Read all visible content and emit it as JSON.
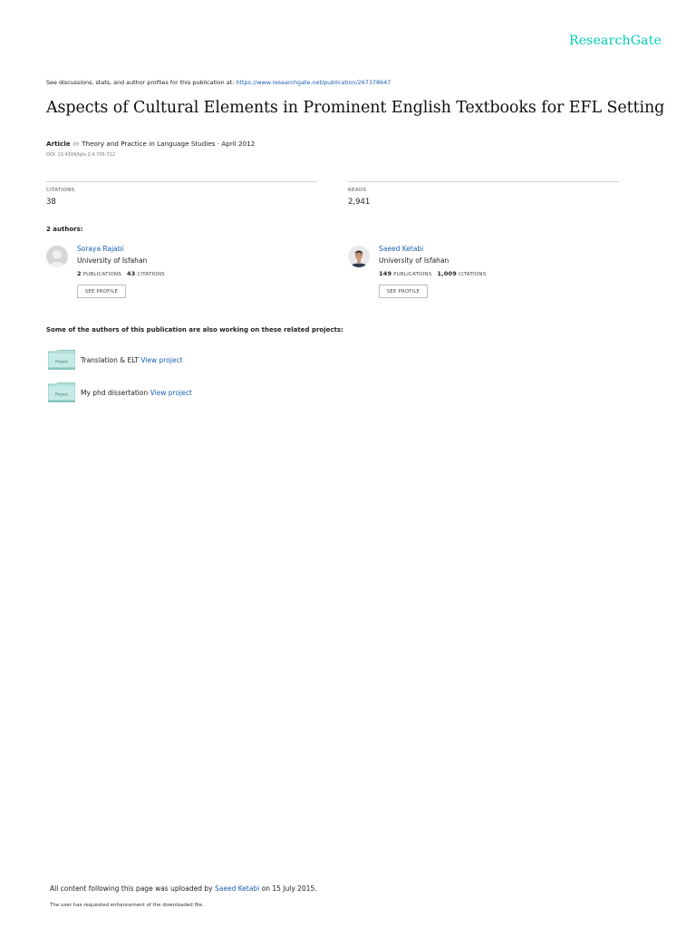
{
  "brand": {
    "name": "ResearchGate"
  },
  "discussion": {
    "prefix": "See discussions, stats, and author profiles for this publication at: ",
    "url": "https://www.researchgate.net/publication/267378647"
  },
  "publication": {
    "title": "Aspects of Cultural Elements in Prominent English Textbooks for EFL Setting",
    "type": "Article",
    "in_word": "in",
    "journal_date": "Theory and Practice in Language Studies · April 2012",
    "doi": "DOI: 10.4304/tpls.2.4.705-712"
  },
  "stats": {
    "citations_label": "CITATIONS",
    "citations_value": "38",
    "reads_label": "READS",
    "reads_value": "2,941"
  },
  "authors_count": "2 authors:",
  "authors": [
    {
      "name": "Soraya Rajabi",
      "institution": "University of Isfahan",
      "publications_count": "2",
      "publications_label": "PUBLICATIONS",
      "citations_count": "43",
      "citations_label": "CITATIONS",
      "button_label": "SEE PROFILE"
    },
    {
      "name": "Saeed Ketabi",
      "institution": "University of Isfahan",
      "publications_count": "149",
      "publications_label": "PUBLICATIONS",
      "citations_count": "1,009",
      "citations_label": "CITATIONS",
      "button_label": "SEE PROFILE"
    }
  ],
  "related_heading": "Some of the authors of this publication are also working on these related projects:",
  "projects": [
    {
      "icon_label": "Project",
      "name": "Translation & ELT",
      "link": "View project"
    },
    {
      "icon_label": "Project",
      "name": "My phd dissertation",
      "link": "View project"
    }
  ],
  "footer": {
    "uploaded_prefix": "All content following this page was uploaded by ",
    "uploader": "Saeed Ketabi",
    "uploaded_suffix": " on 15 July 2015.",
    "enhancement_note": "The user has requested enhancement of the downloaded file."
  },
  "colors": {
    "brand": "#00ccbb",
    "link": "#1a5fb4",
    "project_icon": "#b2e0da"
  }
}
